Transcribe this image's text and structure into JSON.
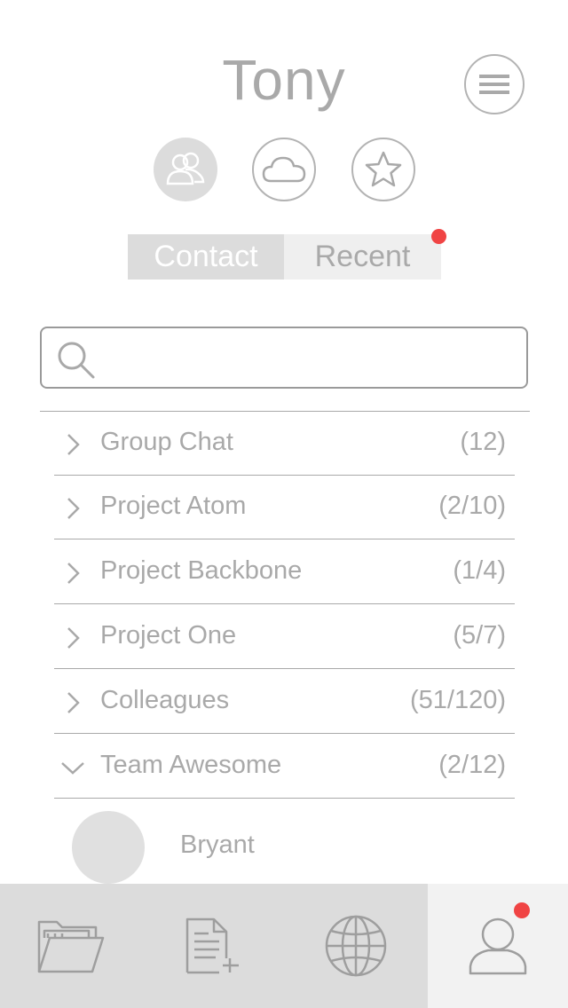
{
  "header": {
    "title": "Tony",
    "menu_icon": "hamburger-menu-icon"
  },
  "quick_actions": [
    {
      "icon": "contacts-icon",
      "active": true
    },
    {
      "icon": "cloud-icon",
      "active": false
    },
    {
      "icon": "star-icon",
      "active": false
    }
  ],
  "tabs": {
    "contact_label": "Contact",
    "recent_label": "Recent",
    "active": "Contact",
    "recent_has_notification": true
  },
  "search": {
    "placeholder": "",
    "value": "",
    "icon": "search-icon"
  },
  "groups": [
    {
      "label": "Group Chat",
      "count": "(12)",
      "expanded": false
    },
    {
      "label": "Project Atom",
      "count": "(2/10)",
      "expanded": false
    },
    {
      "label": "Project Backbone",
      "count": "(1/4)",
      "expanded": false
    },
    {
      "label": "Project One",
      "count": "(5/7)",
      "expanded": false
    },
    {
      "label": "Colleagues",
      "count": "(51/120)",
      "expanded": false
    },
    {
      "label": "Team Awesome",
      "count": "(2/12)",
      "expanded": true
    }
  ],
  "members": [
    {
      "name": "Bryant"
    }
  ],
  "tab_bar": [
    {
      "icon": "folder-icon",
      "active": false
    },
    {
      "icon": "new-document-icon",
      "active": false
    },
    {
      "icon": "globe-icon",
      "active": false
    },
    {
      "icon": "profile-icon",
      "active": true,
      "has_notification": true
    }
  ],
  "colors": {
    "accent_notification": "#f04444",
    "active_fill": "#dcdcdc",
    "text": "#a9a9a9"
  }
}
